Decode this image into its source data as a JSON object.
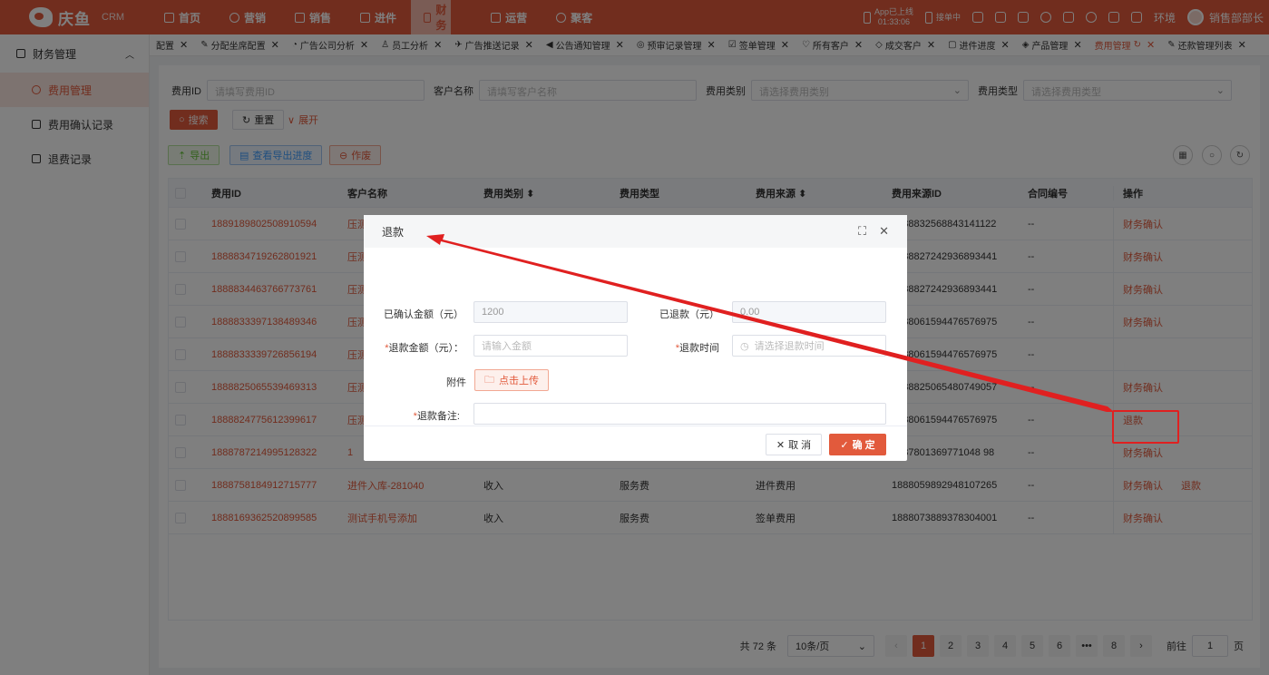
{
  "topbar": {
    "logo_text": "庆鱼",
    "logo_sub": "CRM",
    "nav": [
      {
        "label": "首页",
        "icon": "home-icon"
      },
      {
        "label": "营销",
        "icon": "target-icon"
      },
      {
        "label": "销售",
        "icon": "grid-icon"
      },
      {
        "label": "进件",
        "icon": "doc-icon"
      },
      {
        "label": "财务",
        "icon": "finance-icon",
        "active": true
      },
      {
        "label": "运营",
        "icon": "chat-icon"
      },
      {
        "label": "聚客",
        "icon": "people-icon"
      }
    ],
    "app_status_line1": "App已上线",
    "app_status_line2": "01:33:06",
    "jump_status": "接单中",
    "env_label": "环境",
    "user_name": "销售部部长"
  },
  "sidebar": {
    "group_label": "财务管理",
    "items": [
      {
        "label": "费用管理",
        "active": true
      },
      {
        "label": "费用确认记录"
      },
      {
        "label": "退费记录"
      }
    ]
  },
  "tabs": [
    "配置",
    "分配坐席配置",
    "广告公司分析",
    "员工分析",
    "广告推送记录",
    "公告通知管理",
    "预审记录管理",
    "签单管理",
    "所有客户",
    "成交客户",
    "进件进度",
    "产品管理",
    "费用管理",
    "还款管理列表"
  ],
  "filter": {
    "fee_id_label": "费用ID",
    "fee_id_placeholder": "请填写费用ID",
    "customer_label": "客户名称",
    "customer_placeholder": "请填写客户名称",
    "fee_category_label": "费用类别",
    "fee_category_placeholder": "请选择费用类别",
    "fee_type_label": "费用类型",
    "fee_type_placeholder": "请选择费用类型",
    "search_label": "搜索",
    "reset_label": "重置",
    "expand_label": "展开"
  },
  "actions": {
    "export_label": "导出",
    "export_progress_label": "查看导出进度",
    "void_label": "作废"
  },
  "table": {
    "headers": [
      "费用ID",
      "客户名称",
      "费用类别",
      "费用类型",
      "费用来源",
      "费用来源ID",
      "合同编号",
      "操作"
    ],
    "rows": [
      {
        "id": "1889189802508910594",
        "customer": "压测",
        "category": "",
        "type": "",
        "source": "",
        "source_id": "1888832568843141122",
        "contract": "--",
        "ops": [
          "财务确认"
        ]
      },
      {
        "id": "1888834719262801921",
        "customer": "压测",
        "category": "",
        "type": "",
        "source": "",
        "source_id": "1888827242936893441",
        "contract": "--",
        "ops": [
          "财务确认"
        ]
      },
      {
        "id": "1888834463766773761",
        "customer": "压测",
        "category": "",
        "type": "",
        "source": "",
        "source_id": "1888827242936893441",
        "contract": "--",
        "ops": [
          "财务确认"
        ]
      },
      {
        "id": "1888833397138489346",
        "customer": "压测",
        "category": "",
        "type": "",
        "source": "",
        "source_id": "1888061594476576975",
        "contract": "--",
        "ops": [
          "财务确认"
        ]
      },
      {
        "id": "1888833339726856194",
        "customer": "压测",
        "category": "",
        "type": "",
        "source": "",
        "source_id": "1888061594476576975",
        "contract": "--",
        "ops": []
      },
      {
        "id": "1888825065539469313",
        "customer": "压测",
        "category": "",
        "type": "",
        "source": "",
        "source_id": "1888825065480749057",
        "contract": "--",
        "ops": [
          "财务确认"
        ]
      },
      {
        "id": "1888824775612399617",
        "customer": "压测",
        "category": "",
        "type": "",
        "source": "",
        "source_id": "1888061594476576975",
        "contract": "--",
        "ops": [
          "退款"
        ]
      },
      {
        "id": "1888787214995128322",
        "customer": "1",
        "category": "",
        "type": "",
        "source": "",
        "source_id": "1887801369771048 98",
        "contract": "--",
        "ops": [
          "财务确认"
        ]
      },
      {
        "id": "1888758184912715777",
        "customer": "进件入库-281040",
        "category": "收入",
        "type": "服务费",
        "source": "进件费用",
        "source_id": "1888059892948107265",
        "contract": "--",
        "ops": [
          "财务确认",
          "退款"
        ]
      },
      {
        "id": "1888169362520899585",
        "customer": "测试手机号添加",
        "category": "收入",
        "type": "服务费",
        "source": "签单费用",
        "source_id": "1888073889378304001",
        "contract": "--",
        "ops": [
          "财务确认"
        ]
      }
    ]
  },
  "pagination": {
    "total": "共 72 条",
    "page_size": "10条/页",
    "pages": [
      "1",
      "2",
      "3",
      "4",
      "5",
      "6",
      "•••",
      "8"
    ],
    "goto_label": "前往",
    "goto_value": "1",
    "page_unit": "页"
  },
  "modal": {
    "title": "退款",
    "confirmed_amount_label": "已确认金额（元）",
    "confirmed_amount_value": "1200",
    "refunded_label": "已退款（元）",
    "refunded_value": "0.00",
    "refund_amount_label": "退款金额（元）：",
    "refund_amount_placeholder": "请输入金额",
    "refund_time_label": "退款时间",
    "refund_time_placeholder": "请选择退款时间",
    "attachment_label": "附件",
    "upload_label": "点击上传",
    "remark_label": "退款备注:",
    "cancel_label": "取 消",
    "confirm_label": "确 定"
  },
  "colors": {
    "accent": "#e25a3c",
    "annotation": "#e02020"
  }
}
